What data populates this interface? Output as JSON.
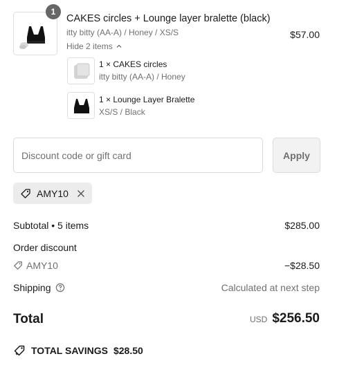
{
  "product": {
    "quantity_badge": "1",
    "title": "CAKES circles + Lounge layer bralette (black)",
    "variant": "itty bitty (AA-A) / Honey / XS/S",
    "toggle_label": "Hide 2 items",
    "price": "$57.00",
    "bundle_items": [
      {
        "title": "1 × CAKES circles",
        "variant": "itty bitty (AA-A) / Honey"
      },
      {
        "title": "1 × Lounge Layer Bralette",
        "variant": "XS/S / Black"
      }
    ]
  },
  "discount": {
    "placeholder": "Discount code or gift card",
    "apply_label": "Apply",
    "applied_code": "AMY10"
  },
  "summary": {
    "subtotal_label": "Subtotal • 5 items",
    "subtotal_value": "$285.00",
    "order_discount_label": "Order discount",
    "discount_code": "AMY10",
    "discount_value": "−$28.50",
    "shipping_label": "Shipping",
    "shipping_value": "Calculated at next step",
    "total_label": "Total",
    "currency": "USD",
    "total_value": "$256.50",
    "savings_label": "TOTAL SAVINGS",
    "savings_value": "$28.50"
  },
  "icons": {
    "tag": "tag-icon",
    "close": "close-icon",
    "chevron": "chevron-up-icon",
    "help": "help-circle-icon",
    "savings": "savings-tag-icon"
  },
  "colors": {
    "text": "#1a1a1a",
    "muted": "#707070",
    "badge": "#666666",
    "chip_bg": "#ececec",
    "button_bg": "#f2f2f2"
  }
}
